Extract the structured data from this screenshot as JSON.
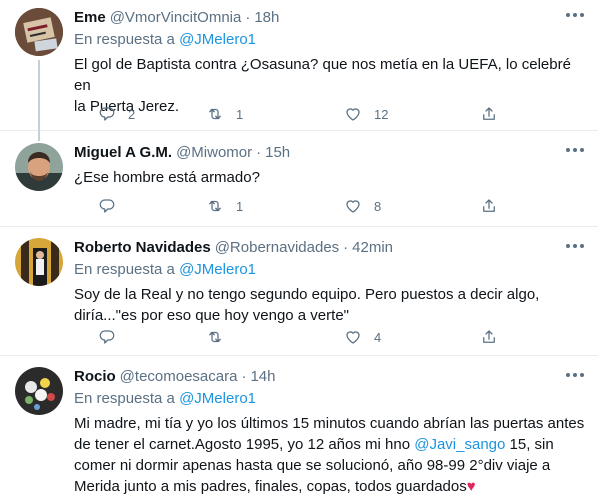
{
  "tweets": [
    {
      "name": "Eme",
      "handle": "@VmorVincitOmnia",
      "dot": "·",
      "time": "18h",
      "reply_prefix": "En respuesta a",
      "reply_to": "@JMelero1",
      "text_lines": [
        "El gol de Baptista contra ¿Osasuna?  que nos metía en la UEFA, lo celebré en",
        "la Puerta Jerez."
      ],
      "reply_count": "2",
      "retweet_count": "1",
      "like_count": "12"
    },
    {
      "name": "Miguel A G.M.",
      "handle": "@Miwomor",
      "dot": "·",
      "time": "15h",
      "text_lines": [
        "¿Ese hombre está armado?"
      ],
      "reply_count": "",
      "retweet_count": "1",
      "like_count": "8"
    },
    {
      "name": "Roberto Navidades",
      "handle": "@Robernavidades",
      "dot": "·",
      "time": "42min",
      "reply_prefix": "En respuesta a",
      "reply_to": "@JMelero1",
      "text_lines": [
        "Soy de la Real y no tengo segundo equipo. Pero puestos a decir algo,",
        "diría...\"es por eso que hoy vengo a verte\""
      ],
      "reply_count": "",
      "retweet_count": "",
      "like_count": "4"
    },
    {
      "name": "Rocio",
      "handle": "@tecomoesacara",
      "dot": "·",
      "time": "14h",
      "reply_prefix": "En respuesta a",
      "reply_to": "@JMelero1",
      "text_line1": "Mi madre, mi tía y yo los últimos 15 minutos cuando abrían las puertas antes",
      "text_line2_pre": "de tener el carnet.Agosto 1995, yo 12 años mi hno ",
      "text_line2_mention": "@Javi_sango",
      "text_line2_post": " 15, sin",
      "text_line3": "comer ni dormir apenas hasta que se solucionó, año 98-99 2°div viaje a",
      "text_line4": "Merida junto a mis padres, finales, copas, todos guardados",
      "heart": "♥"
    }
  ],
  "icons": [
    "reply-icon",
    "retweet-icon",
    "like-icon",
    "share-icon",
    "more-icon"
  ],
  "colors": {
    "link": "#1b95e0",
    "secondary_text": "#5b7083",
    "heart": "#e0245e",
    "divider": "#e6ecf0"
  }
}
